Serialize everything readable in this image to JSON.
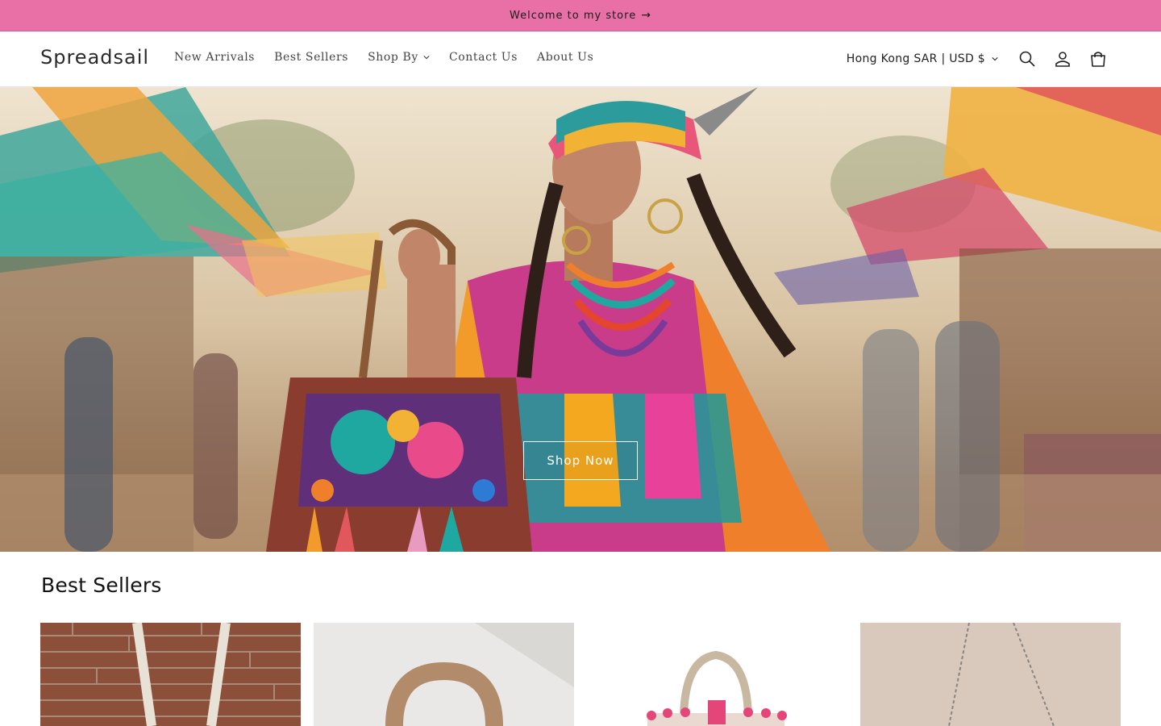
{
  "announcement": {
    "text": "Welcome to my store",
    "arrow": "→"
  },
  "header": {
    "logo": "Spreadsail",
    "nav": [
      {
        "label": "New Arrivals"
      },
      {
        "label": "Best Sellers"
      },
      {
        "label": "Shop By",
        "has_dropdown": true
      },
      {
        "label": "Contact Us"
      },
      {
        "label": "About Us"
      }
    ],
    "currency": "Hong Kong SAR | USD $",
    "icons": [
      "search-icon",
      "account-icon",
      "cart-icon"
    ]
  },
  "hero": {
    "button_label": "Shop Now"
  },
  "best_sellers": {
    "title": "Best Sellers",
    "products": [
      {
        "icon": "woven-tote-image"
      },
      {
        "icon": "wooden-handle-bag-image"
      },
      {
        "icon": "pompom-tote-image"
      },
      {
        "icon": "chain-bag-image"
      }
    ]
  },
  "colors": {
    "announcement_bg": "#e970a6",
    "text": "#121212",
    "nav_text": "#444444"
  }
}
